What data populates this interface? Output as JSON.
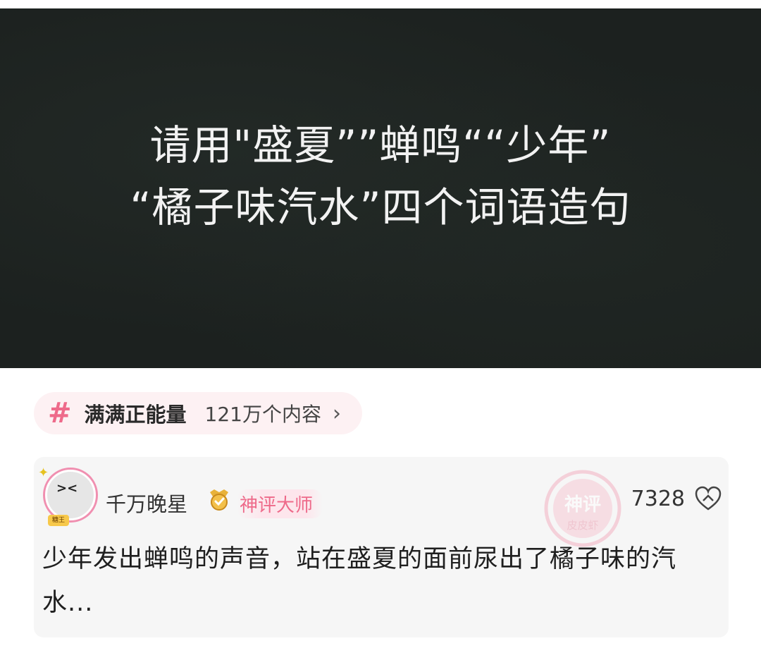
{
  "hero": {
    "line1": "请用\"盛夏””蝉鸣““少年”",
    "line2": "“橘子味汽水”四个词语造句"
  },
  "tag": {
    "name": "满满正能量",
    "count": "121万个内容",
    "icon": "hashtag-icon"
  },
  "comment": {
    "username": "千万晚星",
    "badge": "神评大师",
    "avatar_badge_text": "糖王",
    "likes": "7328",
    "stamp_text_top": "神评",
    "stamp_text_bottom": "皮皮虾",
    "text": "少年发出蝉鸣的声音，站在盛夏的面前尿出了橘子味的汽水..."
  },
  "colors": {
    "hero_bg": "#1c211f",
    "accent_pink": "#ee6a8a",
    "card_bg": "#f6f6f6"
  }
}
